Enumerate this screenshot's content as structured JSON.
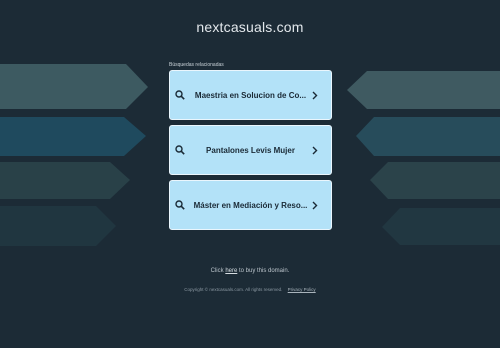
{
  "site": {
    "domain": "nextcasuals.com"
  },
  "related": {
    "caption": "Búsquedas relacionadas",
    "items": [
      {
        "label": "Maestria en Solucion de Co..."
      },
      {
        "label": "Pantalones Levis Mujer"
      },
      {
        "label": "Máster en Mediación y Reso..."
      }
    ]
  },
  "buy": {
    "prefix": "Click ",
    "link": "here",
    "suffix": " to buy this domain."
  },
  "footer": {
    "copyright": "Copyright © nextcasuals.com.  All rights reserved.",
    "privacy": "Privacy Policy"
  },
  "colors": {
    "background": "#1c2b36",
    "card": "#b3e2f8",
    "card_border": "#eaf6fd",
    "text_dark": "#1a2a36"
  },
  "icons": {
    "search": "search-icon",
    "chevron": "chevron-right-icon"
  }
}
